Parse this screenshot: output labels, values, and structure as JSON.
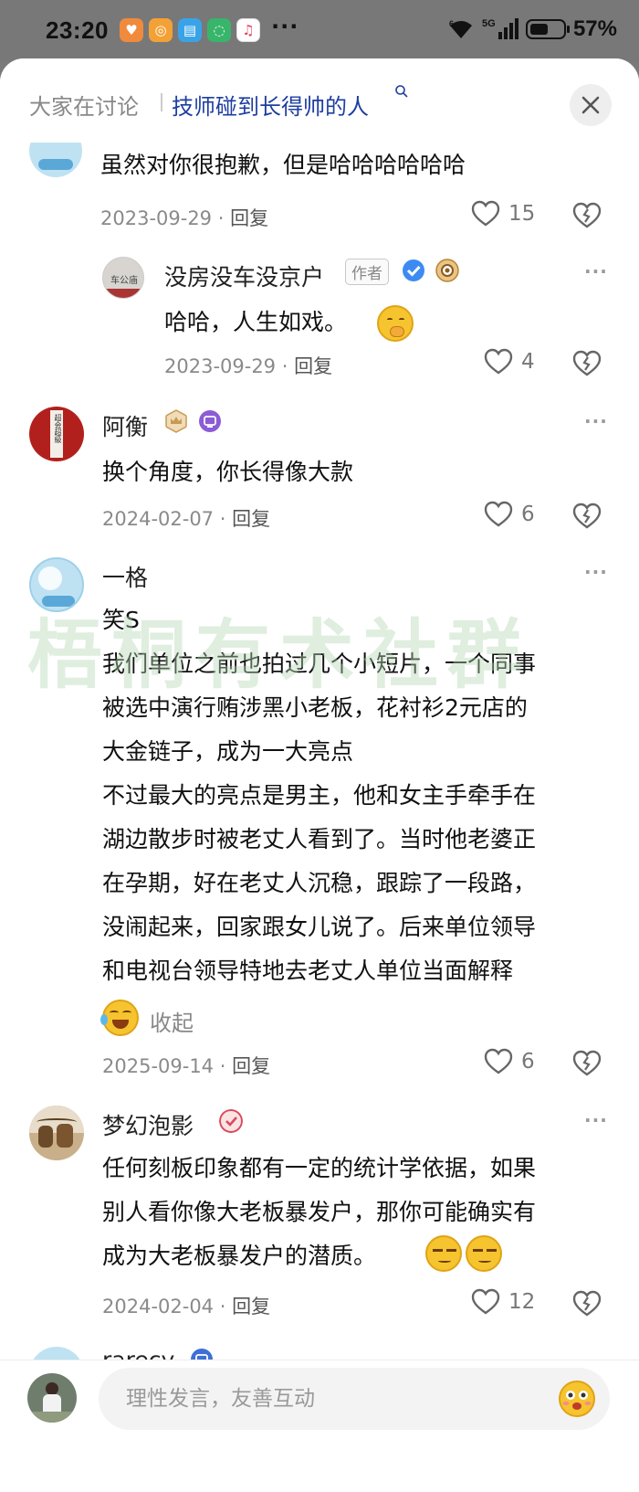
{
  "status_bar": {
    "time": "23:20",
    "network": "5G",
    "battery_percent": "57%",
    "battery_level": 0.57,
    "more_glyph": "···"
  },
  "header": {
    "prefix": "大家在讨论",
    "topic": "技师碰到长得帅的人",
    "search_icon": "search-icon",
    "close_icon": "close-icon"
  },
  "watermark": "梧桐有术社群",
  "comments": [
    {
      "id": "c0",
      "text": "虽然对你很抱歉，但是哈哈哈哈哈哈",
      "date": "2023-09-29",
      "reply_label": "回复",
      "likes": "15"
    },
    {
      "id": "r1",
      "name": "没房没车没京户",
      "author_tag": "作者",
      "avatar_text": "车公庙",
      "text": "哈哈，人生如戏。",
      "emoji": "covering-mouth-emoji",
      "date": "2023-09-29",
      "reply_label": "回复",
      "likes": "4"
    },
    {
      "id": "c2",
      "name": "阿衡",
      "avatar_text": "超会超級",
      "text": "换个角度，你长得像大款",
      "date": "2024-02-07",
      "reply_label": "回复",
      "likes": "6"
    },
    {
      "id": "c3",
      "name": "一格",
      "text_lines": [
        "笑S",
        "我们单位之前也拍过几个小短片，一个同事",
        "被选中演行贿涉黑小老板，花衬衫2元店的",
        "大金链子，成为一大亮点",
        "不过最大的亮点是男主，他和女主手牵手在",
        "湖边散步时被老丈人看到了。当时他老婆正",
        "在孕期，好在老丈人沉稳，跟踪了一段路，",
        "没闹起来，回家跟女儿说了。后来单位领导",
        "和电视台领导特地去老丈人单位当面解释"
      ],
      "collapse_label": "收起",
      "date": "2025-09-14",
      "reply_label": "回复",
      "likes": "6"
    },
    {
      "id": "c4",
      "name": "梦幻泡影",
      "text_lines": [
        "任何刻板印象都有一定的统计学依据，如果",
        "别人看你像大老板暴发户，那你可能确实有",
        "成为大老板暴发户的潜质。"
      ],
      "date": "2024-02-04",
      "reply_label": "回复",
      "likes": "12"
    },
    {
      "id": "c5",
      "name": "rarecy"
    }
  ],
  "composer": {
    "placeholder": "理性发言，友善互动",
    "emoji_icon": "emoji-icon"
  },
  "colors": {
    "topic_blue": "#1e3ea0",
    "verified_blue": "#3d8bf2",
    "watermark_green": "#b2d7b2"
  }
}
